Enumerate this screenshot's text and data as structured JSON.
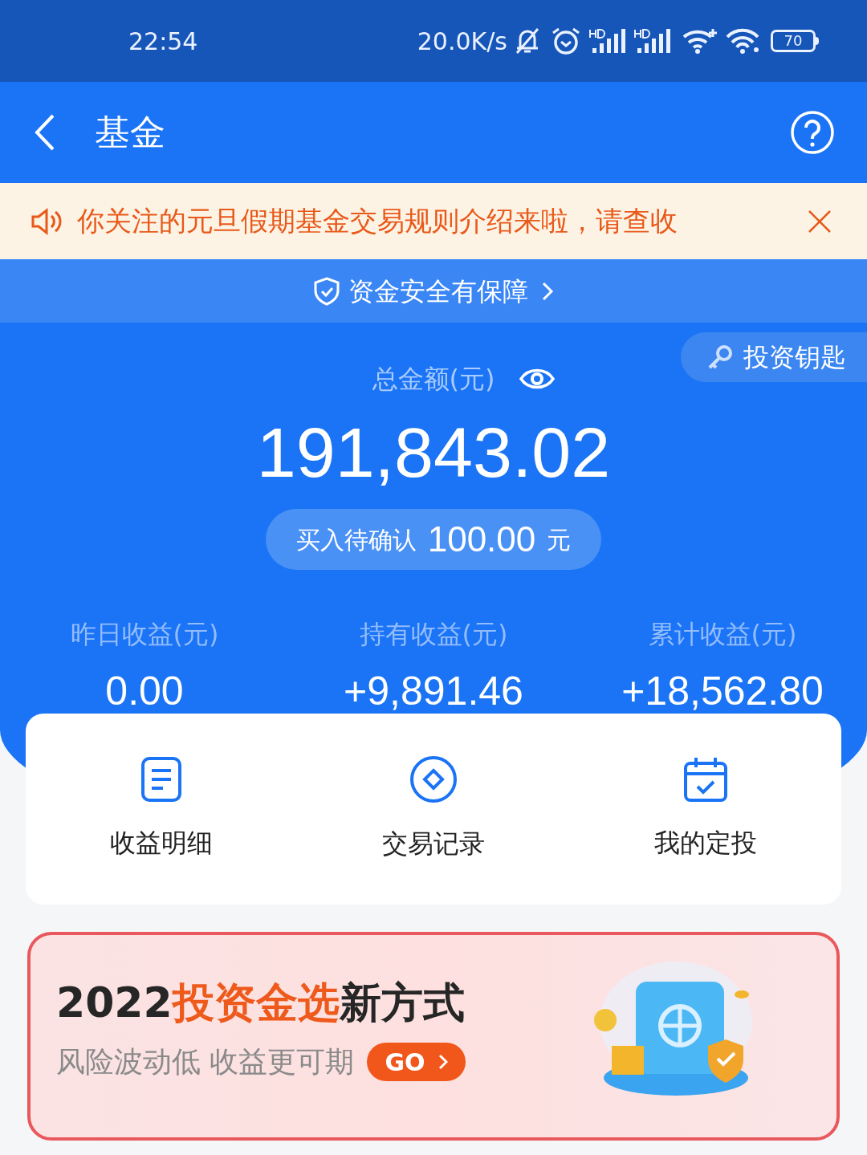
{
  "status_bar": {
    "time": "22:54",
    "speed": "20.0K/s",
    "battery": "70"
  },
  "header": {
    "title": "基金"
  },
  "notice": {
    "text": "你关注的元旦假期基金交易规则介绍来啦，请查收"
  },
  "security_link": {
    "text": "资金安全有保障"
  },
  "invest_key": {
    "label": "投资钥匙"
  },
  "total": {
    "label": "总金额(元)",
    "amount": "191,843.02"
  },
  "pending": {
    "label": "买入待确认",
    "amount": "100.00",
    "unit": "元"
  },
  "stats": [
    {
      "label": "昨日收益(元)",
      "value": "0.00"
    },
    {
      "label": "持有收益(元)",
      "value": "+9,891.46"
    },
    {
      "label": "累计收益(元)",
      "value": "+18,562.80"
    }
  ],
  "actions": [
    {
      "kind": "document",
      "label": "收益明细"
    },
    {
      "kind": "coin",
      "label": "交易记录"
    },
    {
      "kind": "calendar",
      "label": "我的定投"
    }
  ],
  "banner": {
    "title": [
      {
        "text": "2022",
        "highlight": false
      },
      {
        "text": "投资金选",
        "highlight": true
      },
      {
        "text": "新方式",
        "highlight": false
      }
    ],
    "subtitle": "风险波动低 收益更可期",
    "button": "GO"
  }
}
